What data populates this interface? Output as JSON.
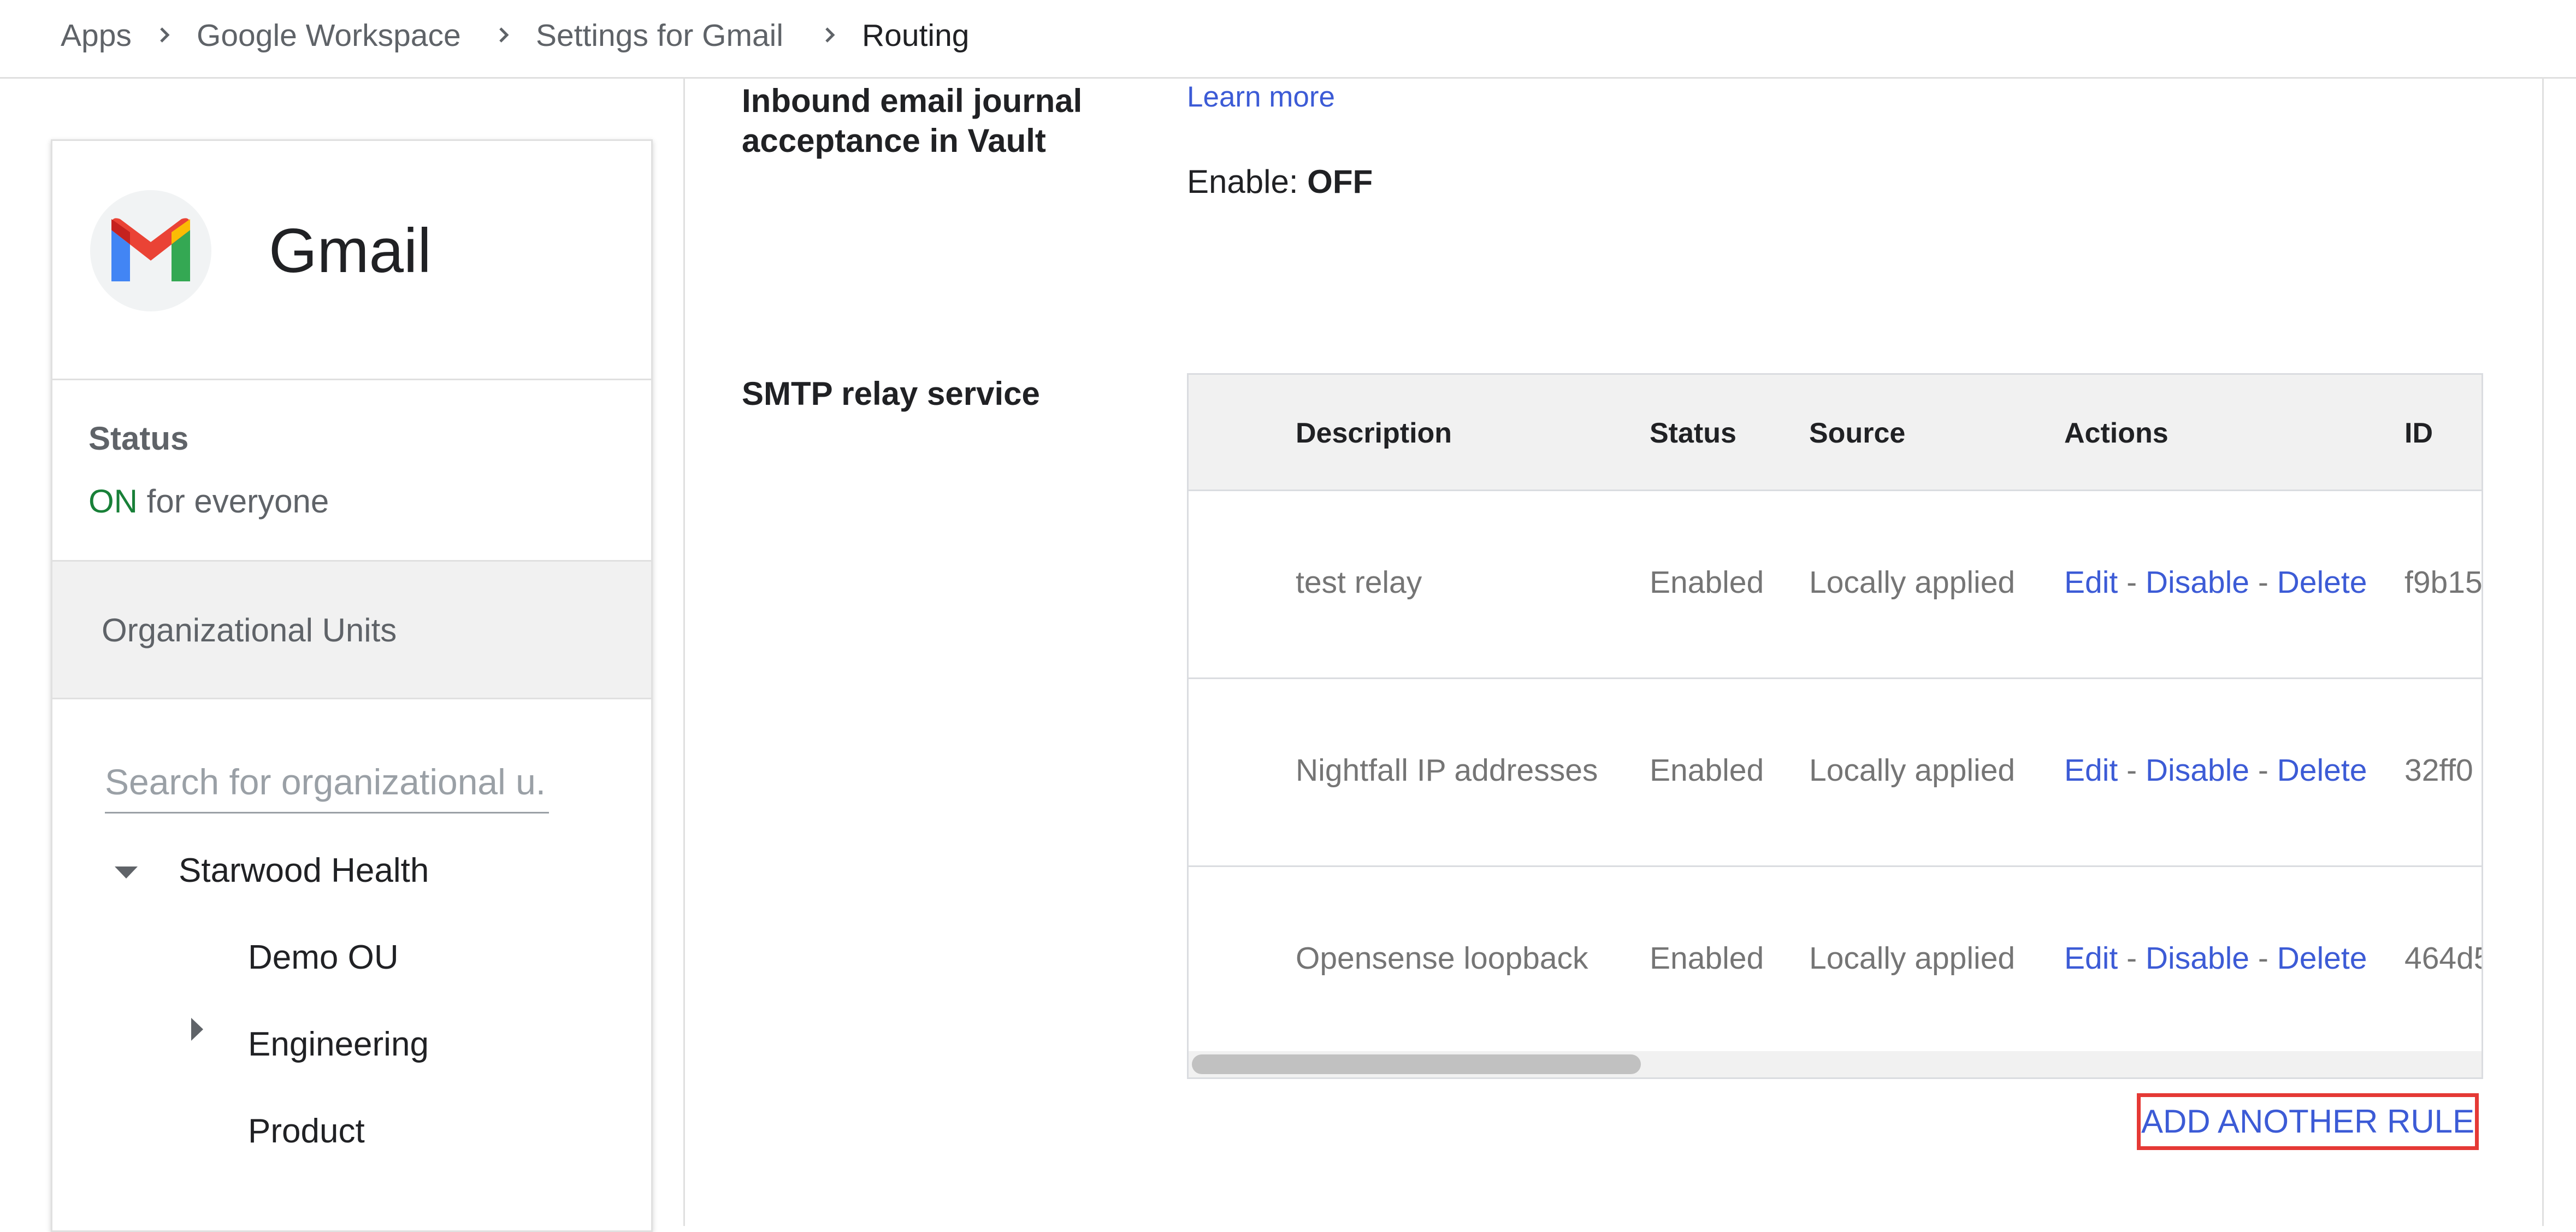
{
  "breadcrumb": {
    "items": [
      "Apps",
      "Google Workspace",
      "Settings for Gmail"
    ],
    "current": "Routing"
  },
  "sidebar": {
    "app_name": "Gmail",
    "status_label": "Status",
    "status_on": "ON",
    "status_rest": " for everyone",
    "ou_header": "Organizational Units",
    "search_placeholder": "Search for organizational u...",
    "tree": {
      "root": "Starwood Health",
      "children": [
        "Demo OU",
        "Engineering",
        "Product"
      ]
    }
  },
  "main": {
    "journal": {
      "title_line1": "Inbound email journal",
      "title_line2": "acceptance in Vault",
      "learn_more": "Learn more",
      "enable_label": "Enable: ",
      "enable_value": "OFF"
    },
    "smtp": {
      "title": "SMTP relay service",
      "columns": [
        "Description",
        "Status",
        "Source",
        "Actions",
        "ID"
      ],
      "rows": [
        {
          "description": "test relay",
          "status": "Enabled",
          "source": "Locally applied",
          "id": "f9b15"
        },
        {
          "description": "Nightfall IP addresses",
          "status": "Enabled",
          "source": "Locally applied",
          "id": "32ff0"
        },
        {
          "description": "Opensense loopback",
          "status": "Enabled",
          "source": "Locally applied",
          "id": "464d5"
        }
      ],
      "actions": {
        "edit": "Edit",
        "disable": "Disable",
        "delete": "Delete",
        "sep": " - "
      },
      "add_rule": "ADD ANOTHER RULE"
    }
  },
  "colors": {
    "link": "#3c5bd6",
    "on": "#188038",
    "highlight": "#e53935"
  }
}
